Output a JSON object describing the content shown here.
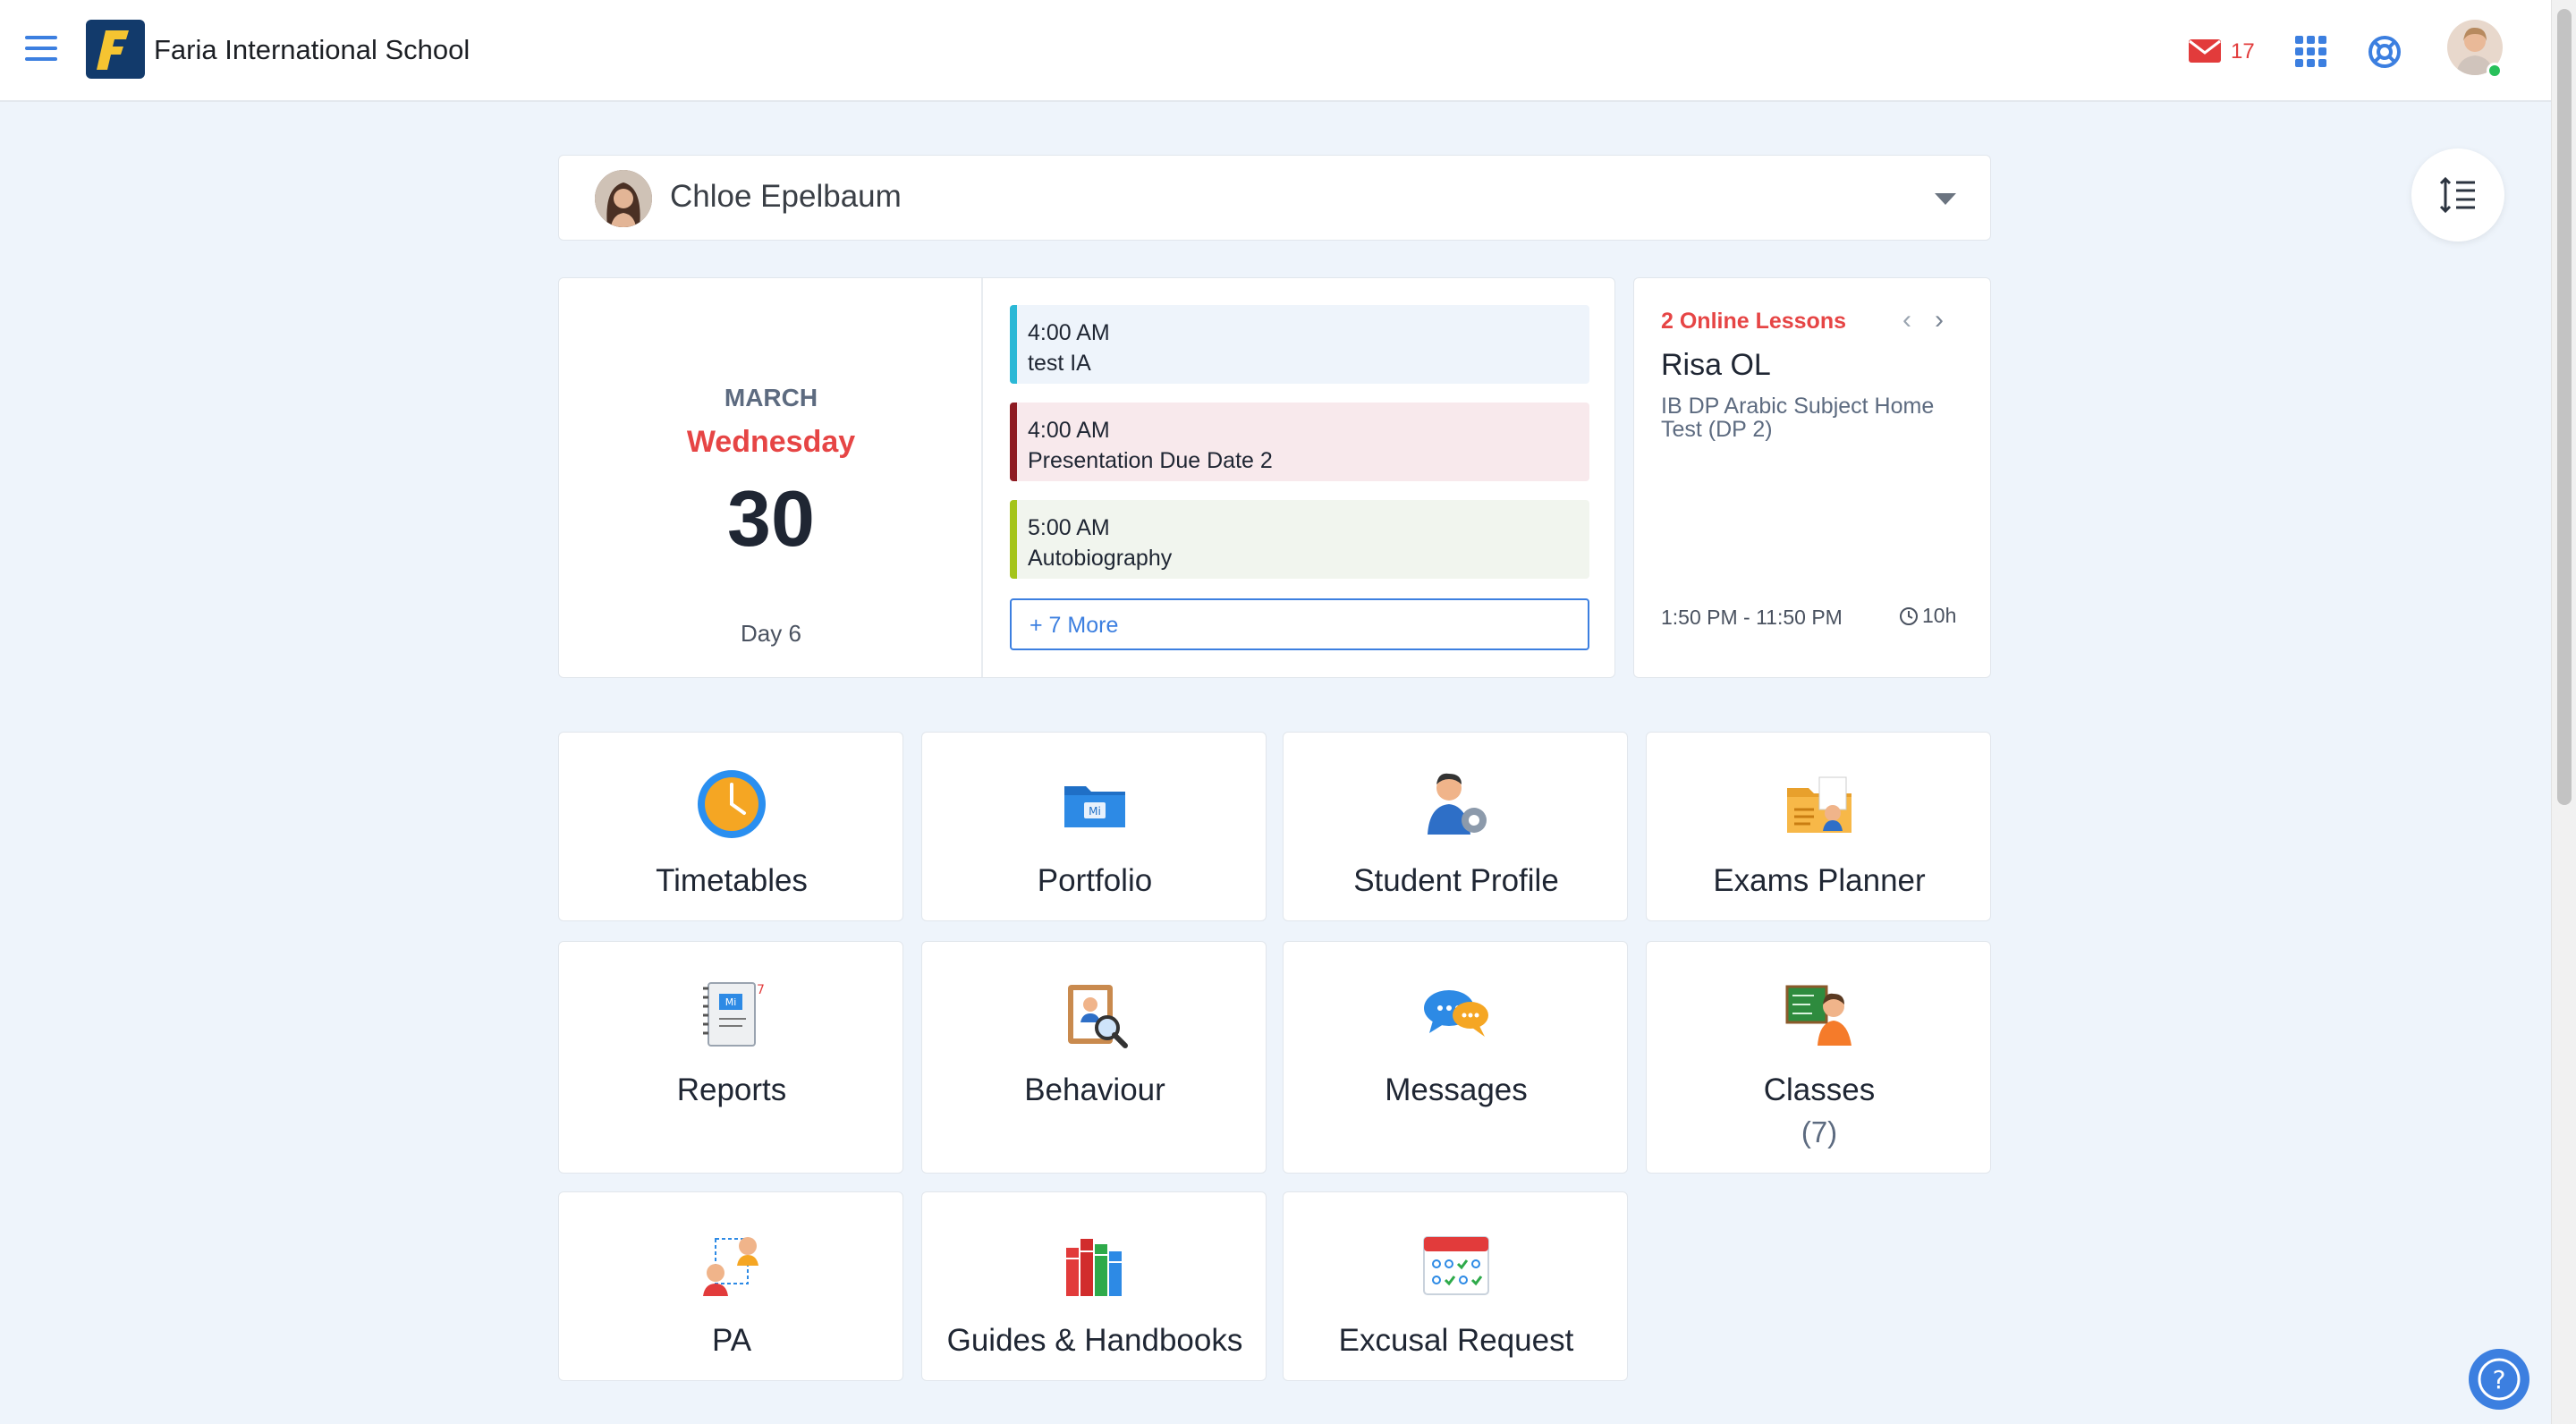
{
  "header": {
    "school_name": "Faria International School",
    "mail_count": "17",
    "accent": "#3c7fe0"
  },
  "student_selector": {
    "name": "Chloe Epelbaum"
  },
  "calendar": {
    "month": "MARCH",
    "weekday": "Wednesday",
    "day": "30",
    "cycle_day": "Day 6",
    "events": [
      {
        "time": "4:00 AM",
        "title": "test IA",
        "bar_color": "#2bb8d6",
        "bg_color": "#eef4fb"
      },
      {
        "time": "4:00 AM",
        "title": "Presentation Due Date 2",
        "bar_color": "#8e1b22",
        "bg_color": "#f8e9ec"
      },
      {
        "time": "5:00 AM",
        "title": "Autobiography",
        "bar_color": "#a4c41a",
        "bg_color": "#f1f5ee"
      }
    ],
    "more_label": "+ 7 More"
  },
  "online_lessons": {
    "count_label": "2 Online Lessons",
    "title": "Risa OL",
    "subject": "IB DP Arabic Subject Home Test (DP 2)",
    "time_range": "1:50 PM - 11:50 PM",
    "duration": "10h"
  },
  "tiles": [
    {
      "label": "Timetables",
      "icon": "clock-icon"
    },
    {
      "label": "Portfolio",
      "icon": "folder-icon"
    },
    {
      "label": "Student Profile",
      "icon": "student-gear-icon"
    },
    {
      "label": "Exams Planner",
      "icon": "exam-folder-icon"
    },
    {
      "label": "Reports",
      "icon": "report-card-icon"
    },
    {
      "label": "Behaviour",
      "icon": "clipboard-magnifier-icon"
    },
    {
      "label": "Messages",
      "icon": "chat-bubbles-icon"
    },
    {
      "label": "Classes",
      "sub": "(7)",
      "icon": "classroom-board-icon"
    },
    {
      "label": "PA",
      "icon": "people-link-icon"
    },
    {
      "label": "Guides & Handbooks",
      "icon": "books-icon"
    },
    {
      "label": "Excusal Request",
      "icon": "attendance-calendar-icon"
    }
  ]
}
